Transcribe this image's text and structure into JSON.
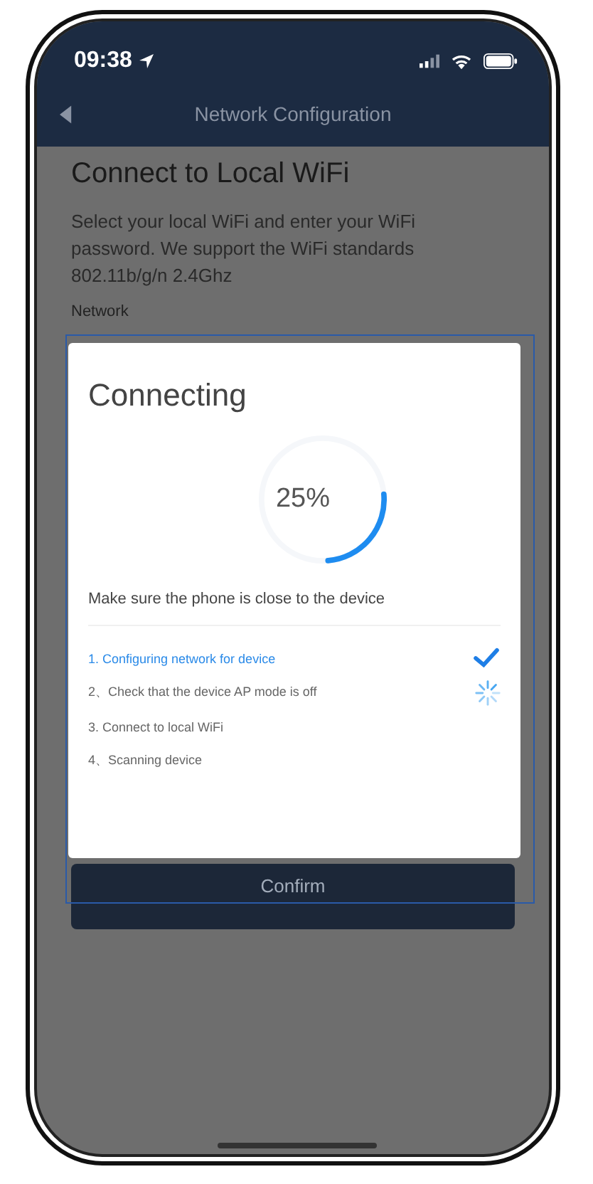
{
  "status_bar": {
    "time": "09:38"
  },
  "nav": {
    "title": "Network Configuration"
  },
  "page": {
    "title": "Connect to Local WiFi",
    "description": "Select your local WiFi and enter your WiFi password. We support the WiFi standards 802.11b/g/n 2.4Ghz",
    "field_label": "Network",
    "confirm": "Confirm"
  },
  "dialog": {
    "title": "Connecting",
    "progress": {
      "level": 0.25,
      "reading": "25%"
    },
    "hint": "Make sure the phone is close to the device",
    "steps": [
      {
        "label": "1. Configuring network for device",
        "kind": "done"
      },
      {
        "label": "2、Check that the device AP mode is off",
        "kind": "loading"
      },
      {
        "label": "3. Connect to local WiFi",
        "kind": "pending"
      },
      {
        "label": "4、Scanning device",
        "kind": "pending"
      }
    ]
  }
}
